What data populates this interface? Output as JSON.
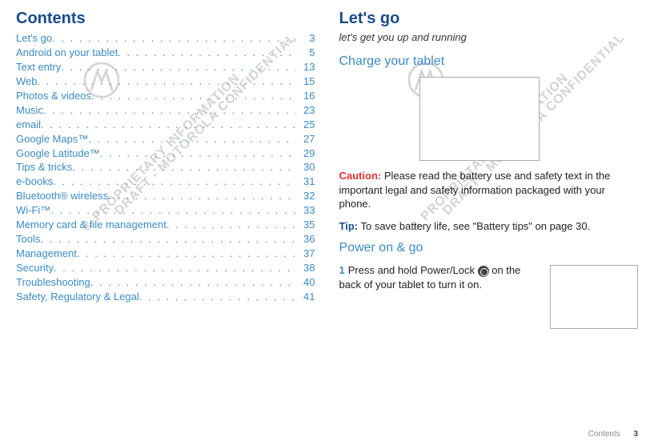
{
  "contents": {
    "heading": "Contents",
    "items": [
      {
        "label": "Let's go",
        "page": "3"
      },
      {
        "label": "Android on your tablet",
        "page": "5"
      },
      {
        "label": "Text entry",
        "page": "13"
      },
      {
        "label": "Web",
        "page": "15"
      },
      {
        "label": "Photos & videos",
        "page": "16"
      },
      {
        "label": "Music",
        "page": "23"
      },
      {
        "label": "email",
        "page": "25"
      },
      {
        "label": "Google Maps™",
        "page": "27"
      },
      {
        "label": "Google Latitude™",
        "page": "29"
      },
      {
        "label": "Tips & tricks",
        "page": "30"
      },
      {
        "label": "e-books",
        "page": "31"
      },
      {
        "label": "Bluetooth® wireless",
        "page": "32"
      },
      {
        "label": "Wi-Fi™",
        "page": "33"
      },
      {
        "label": "Memory card & file management",
        "page": "35"
      },
      {
        "label": "Tools",
        "page": "36"
      },
      {
        "label": "Management",
        "page": "37"
      },
      {
        "label": "Security",
        "page": "38"
      },
      {
        "label": "Troubleshooting",
        "page": "40"
      },
      {
        "label": "Safety, Regulatory & Legal",
        "page": "41"
      }
    ]
  },
  "letsgo": {
    "heading": "Let's go",
    "subtitle": "let's get you up and running",
    "charge_heading": "Charge your tablet",
    "caution_label": "Caution:",
    "caution_text": " Please read the battery use and safety text in the important legal and safety information packaged with your phone.",
    "tip_label": "Tip:",
    "tip_text": " To save battery life, see \"Battery tips\" on page 30.",
    "power_heading": "Power on & go",
    "step1_num": "1",
    "step1_text_a": "Press and hold Power/Lock ",
    "step1_text_b": " on the back of your tablet to turn it on."
  },
  "footer": {
    "section": "Contents",
    "page": "3"
  },
  "watermark": {
    "line1": "DRAFT - MOTOROLA CONFIDENTIAL",
    "line2": "& PROPRIETARY INFORMATION"
  }
}
